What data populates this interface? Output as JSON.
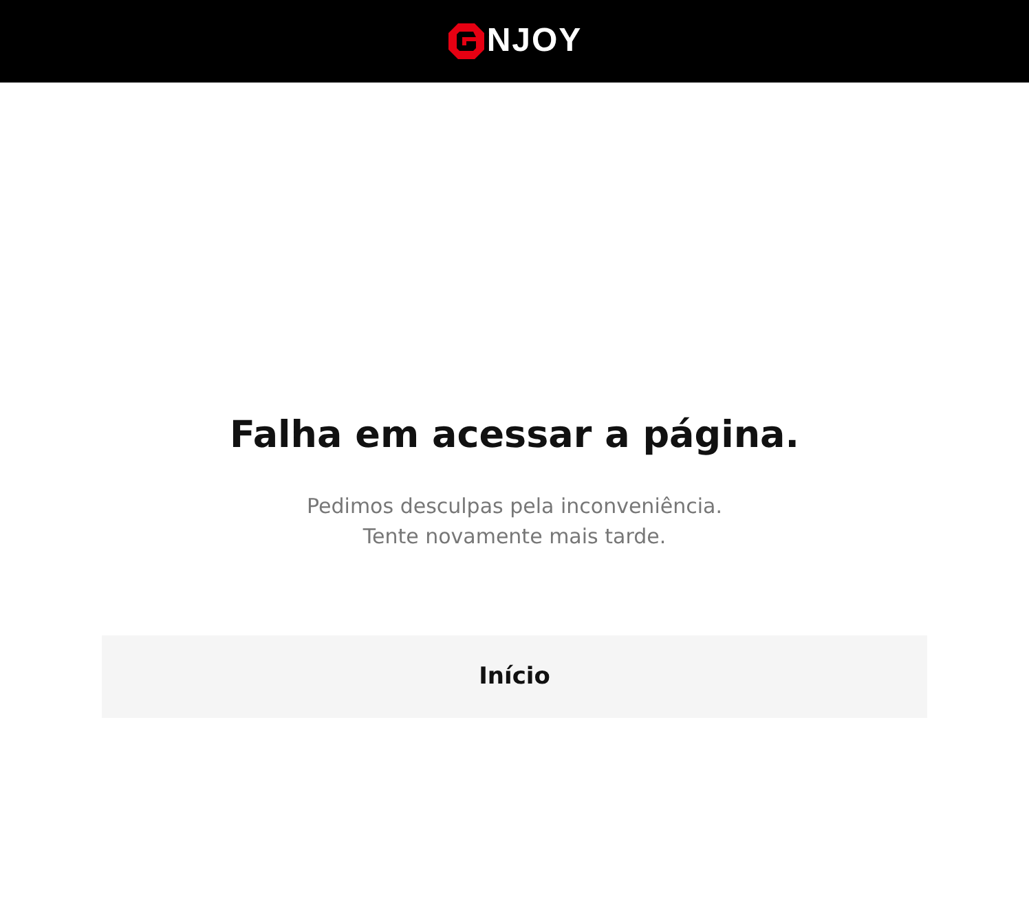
{
  "header": {
    "logo_text": "NJOY"
  },
  "title": "Falha em acessar a página.",
  "message_lines": [
    "Pedimos desculpas pela inconveniência.",
    "Tente novamente mais tarde."
  ],
  "button": "Início"
}
